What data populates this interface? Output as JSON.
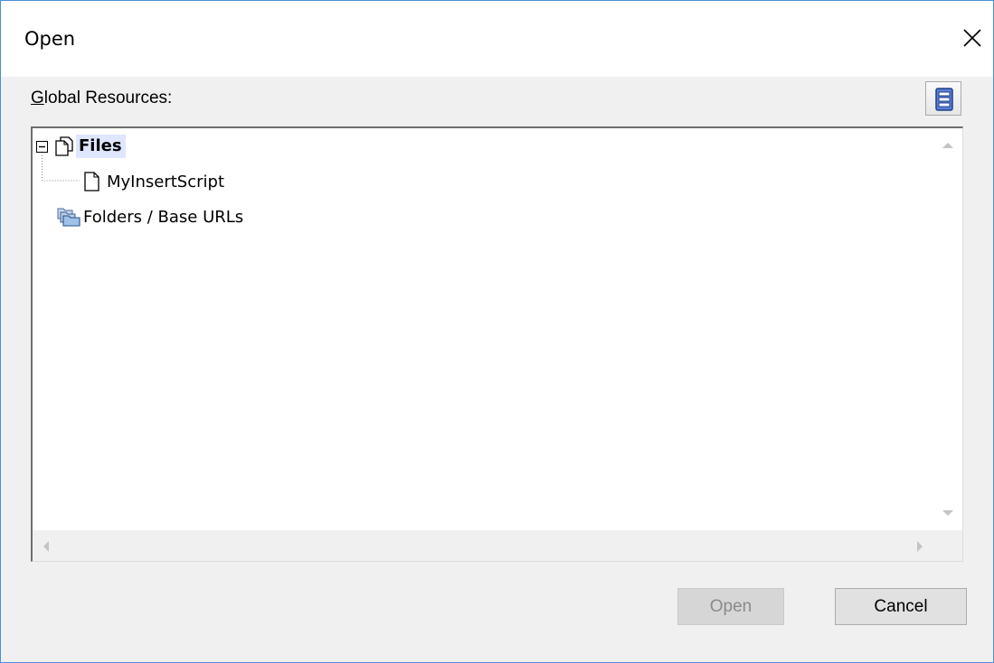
{
  "dialog": {
    "title": "Open",
    "close_glyph": "✕"
  },
  "global_resources": {
    "label_accel": "G",
    "label_rest": "lobal Resources:",
    "manage_icon": "database-icon"
  },
  "tree": {
    "items": [
      {
        "label": "Files",
        "icon": "files-icon",
        "expander": "minus-box",
        "selected": true
      },
      {
        "label": "MyInsertScript",
        "icon": "file-icon"
      },
      {
        "label": "Folders / Base URLs",
        "icon": "folders-icon"
      }
    ]
  },
  "buttons": {
    "open": "Open",
    "cancel": "Cancel"
  },
  "colors": {
    "selection": "#dfe6ff",
    "window_border": "#4a8fd8",
    "dialog_bg": "#f0f0f0"
  }
}
